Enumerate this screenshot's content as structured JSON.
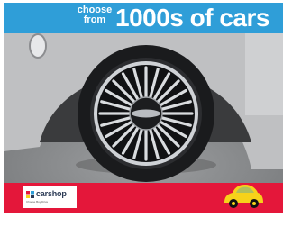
{
  "banner": {
    "tagline_line1": "choose",
    "tagline_line2": "from",
    "headline": "1000s of cars"
  },
  "footer": {
    "brand_name": "carshop",
    "brand_tagline": "Choose Buy Drive"
  },
  "colors": {
    "banner_blue": "#2f9ed8",
    "footer_red": "#e4173a",
    "mascot_yellow": "#f7d21a",
    "car_silver": "#bfc0c2"
  }
}
